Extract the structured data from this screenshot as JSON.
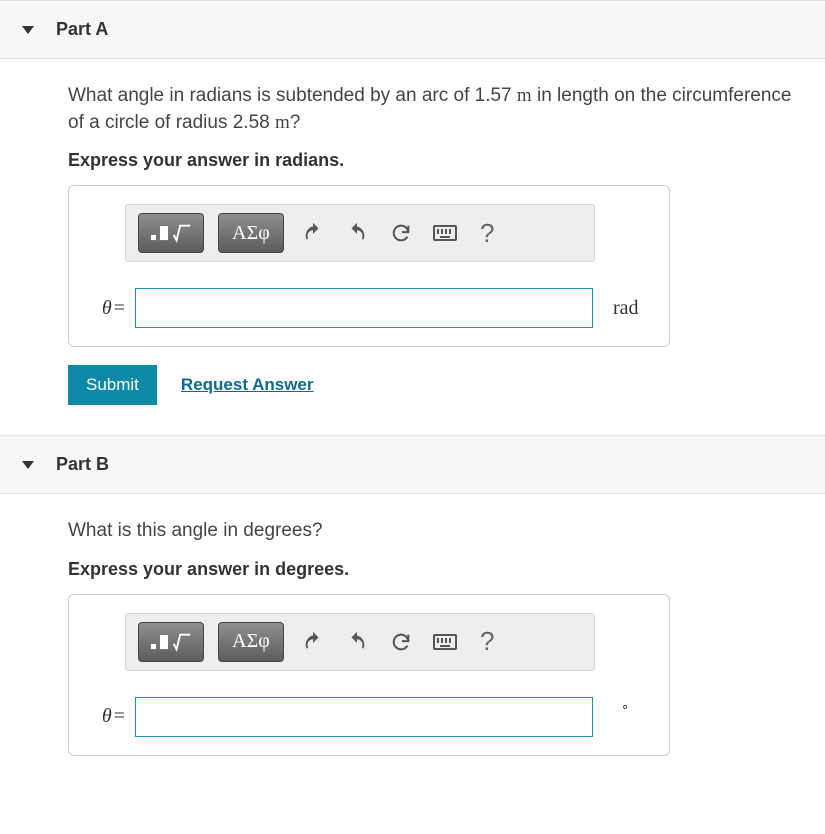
{
  "partA": {
    "title": "Part A",
    "question_pre": "What angle in radians is subtended by an arc of 1.57 ",
    "question_mid": " in length on the circumference of a circle of radius 2.58 ",
    "question_end": "?",
    "unit_m": "m",
    "instruction": "Express your answer in radians.",
    "greek_label": "ΑΣφ",
    "theta": "θ",
    "equals": "=",
    "unit": "rad",
    "submit": "Submit",
    "request": "Request Answer",
    "help": "?"
  },
  "partB": {
    "title": "Part B",
    "question": "What is this angle in degrees?",
    "instruction": "Express your answer in degrees.",
    "greek_label": "ΑΣφ",
    "theta": "θ",
    "equals": "=",
    "unit": "∘",
    "help": "?"
  }
}
